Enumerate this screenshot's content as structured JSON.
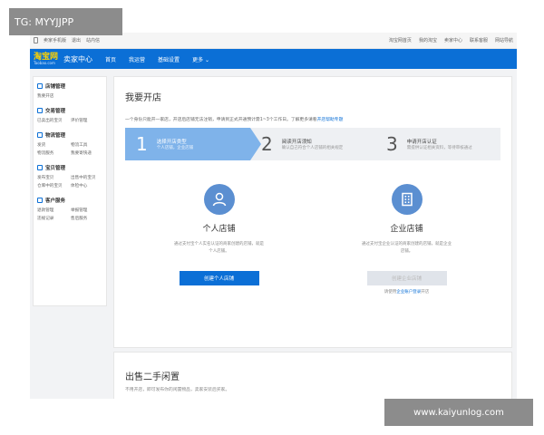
{
  "watermarks": {
    "top_left": "TG: MYYJJPP",
    "bottom_right": "www.kaiyunlog.com"
  },
  "topbar": {
    "left": [
      "卖家手机版",
      "退出",
      "站内信"
    ],
    "right": [
      "淘宝网首页",
      "我的淘宝",
      "卖家中心",
      "联系客服",
      "网站导航"
    ]
  },
  "header": {
    "logo_cn": "淘宝网",
    "logo_en": "Taobao.com",
    "title": "卖家中心",
    "nav": [
      "首页",
      "我运营",
      "基础设置",
      "更多"
    ]
  },
  "sidebar": [
    {
      "title": "店铺管理",
      "items": [
        "我要开店"
      ]
    },
    {
      "title": "交易管理",
      "items": [
        "已卖出的宝贝",
        "评价管理"
      ]
    },
    {
      "title": "物流管理",
      "items": [
        "发货",
        "物流工具",
        "物流服务",
        "我要寄快递"
      ]
    },
    {
      "title": "宝贝管理",
      "items": [
        "发布宝贝",
        "出售中的宝贝",
        "仓库中的宝贝",
        "体检中心"
      ]
    },
    {
      "title": "客户服务",
      "items": [
        "退款管理",
        "举报管理",
        "违规记录",
        "售后服务"
      ]
    }
  ],
  "main": {
    "title": "我要开店",
    "notice_prefix": "一个身份只能开一家店，开店后店铺无法注销，申请到正式开通预计需1~3个工作日。了解更多请看",
    "notice_link": "开店帮助专题",
    "steps": [
      {
        "num": "1",
        "title": "选择开店类型",
        "desc": "个人店铺，企业店铺"
      },
      {
        "num": "2",
        "title": "阅读开店须知",
        "desc": "确认自己符合个人店铺的相关规定"
      },
      {
        "num": "3",
        "title": "申请开店认证",
        "desc": "需提供认证相关资料，等待审核通过"
      }
    ],
    "options": [
      {
        "title": "个人店铺",
        "desc": "通过支付宝个人实名认证的商家创建的店铺，就是个人店铺。",
        "button": "创建个人店铺"
      },
      {
        "title": "企业店铺",
        "desc": "通过支付宝企业认证的商家创建的店铺，就是企业店铺。",
        "button": "创建企业店铺",
        "sub_prefix": "请使用",
        "sub_link": "企业账户登录",
        "sub_suffix": "开店"
      }
    ]
  },
  "section2": {
    "title": "出售二手闲置",
    "desc": "不用开店，即可发布你的闲置物品，卖家安装后买家。"
  },
  "colors": {
    "primary": "#0b6fd6",
    "step_active": "#7fb3ea",
    "icon_bg": "#5b8fd1"
  }
}
